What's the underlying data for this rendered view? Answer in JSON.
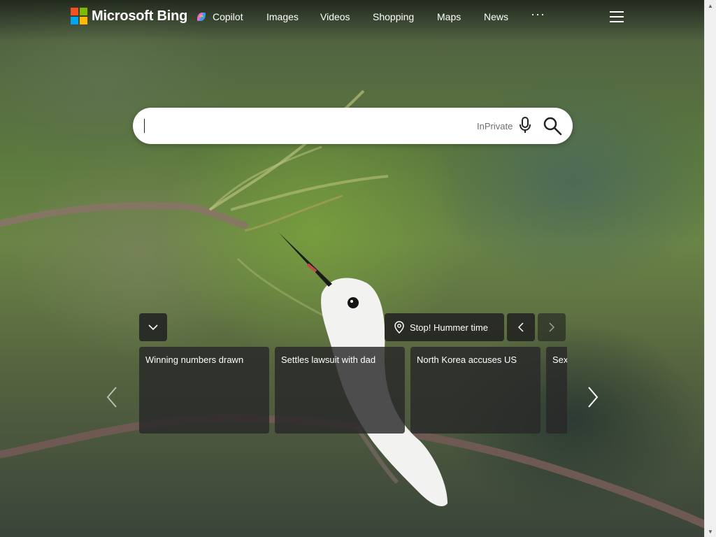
{
  "header": {
    "logo_text": "Microsoft Bing",
    "nav": {
      "copilot": "Copilot",
      "images": "Images",
      "videos": "Videos",
      "shopping": "Shopping",
      "maps": "Maps",
      "news": "News",
      "more": "···"
    }
  },
  "search": {
    "value": "",
    "inprivate_label": "InPrivate"
  },
  "image_of_day": {
    "caption": "Stop! Hummer time"
  },
  "news": {
    "cards": [
      {
        "title": "Winning numbers drawn"
      },
      {
        "title": "Settles lawsuit with dad"
      },
      {
        "title": "North Korea accuses US"
      },
      {
        "title": "Sex"
      }
    ]
  },
  "icons": {
    "logo": "microsoft-logo-icon",
    "copilot": "copilot-icon",
    "menu": "hamburger-menu-icon",
    "mic": "microphone-icon",
    "search": "search-icon",
    "collapse": "chevron-down-icon",
    "location": "location-pin-icon",
    "prev": "chevron-left-icon",
    "next": "chevron-right-icon"
  },
  "colors": {
    "logo_red": "#f25022",
    "logo_green": "#7fba00",
    "logo_blue": "#00a4ef",
    "logo_yellow": "#ffb900"
  }
}
